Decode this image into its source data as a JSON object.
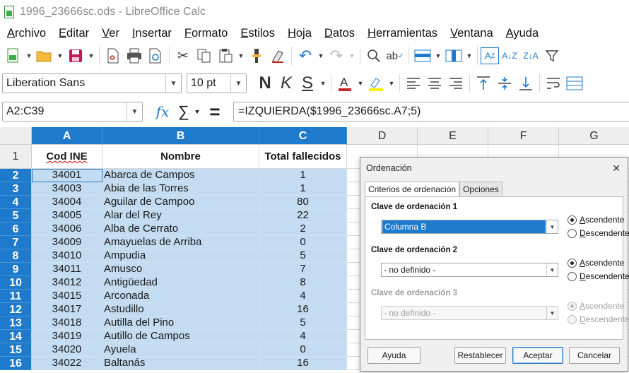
{
  "window": {
    "title": "1996_23666sc.ods - LibreOffice Calc"
  },
  "menu": [
    "Archivo",
    "Editar",
    "Ver",
    "Insertar",
    "Formato",
    "Estilos",
    "Hoja",
    "Datos",
    "Herramientas",
    "Ventana",
    "Ayuda"
  ],
  "toolbar2": {
    "font_name": "Liberation Sans",
    "font_size": "10 pt",
    "bold": "N",
    "italic": "K",
    "underline": "S"
  },
  "formula_bar": {
    "name_box": "A2:C39",
    "formula": "=IZQUIERDA($1996_23666sc.A7;5)",
    "fx": "fx",
    "sum": "∑",
    "equals": "="
  },
  "sheet": {
    "columns": [
      "A",
      "B",
      "C",
      "D",
      "E",
      "F",
      "G"
    ],
    "header_row": {
      "row": "1",
      "a": "Cod INE",
      "b": "Nombre",
      "c": "Total fallecidos"
    },
    "rows": [
      {
        "row": "2",
        "a": "34001",
        "b": "Abarca de Campos",
        "c": "1"
      },
      {
        "row": "3",
        "a": "34003",
        "b": "Abia de las Torres",
        "c": "1"
      },
      {
        "row": "4",
        "a": "34004",
        "b": "Aguilar de Campoo",
        "c": "80"
      },
      {
        "row": "5",
        "a": "34005",
        "b": "Alar del Rey",
        "c": "22"
      },
      {
        "row": "6",
        "a": "34006",
        "b": "Alba de Cerrato",
        "c": "2"
      },
      {
        "row": "7",
        "a": "34009",
        "b": "Amayuelas de Arriba",
        "c": "0"
      },
      {
        "row": "8",
        "a": "34010",
        "b": "Ampudia",
        "c": "5"
      },
      {
        "row": "9",
        "a": "34011",
        "b": "Amusco",
        "c": "7"
      },
      {
        "row": "10",
        "a": "34012",
        "b": "Antigüedad",
        "c": "8"
      },
      {
        "row": "11",
        "a": "34015",
        "b": "Arconada",
        "c": "4"
      },
      {
        "row": "12",
        "a": "34017",
        "b": "Astudillo",
        "c": "16"
      },
      {
        "row": "13",
        "a": "34018",
        "b": "Autilla del Pino",
        "c": "5"
      },
      {
        "row": "14",
        "a": "34019",
        "b": "Autillo de Campos",
        "c": "4"
      },
      {
        "row": "15",
        "a": "34020",
        "b": "Ayuela",
        "c": "0"
      },
      {
        "row": "16",
        "a": "34022",
        "b": "Baltanás",
        "c": "16"
      }
    ]
  },
  "sort_dialog": {
    "title": "Ordenación",
    "tabs": [
      "Criterios de ordenación",
      "Opciones"
    ],
    "keys": [
      {
        "label": "Clave de ordenación 1",
        "value": "Columna B",
        "asc": "Ascendente",
        "desc": "Descendente"
      },
      {
        "label": "Clave de ordenación 2",
        "value": "- no definido -",
        "asc": "Ascendente",
        "desc": "Descendente"
      },
      {
        "label": "Clave de ordenación 3",
        "value": "- no definido -",
        "asc": "Ascendente",
        "desc": "Descendente"
      }
    ],
    "buttons": {
      "help": "Ayuda",
      "reset": "Restablecer",
      "ok": "Aceptar",
      "cancel": "Cancelar"
    }
  },
  "colors": {
    "selection_header": "#1e7acc",
    "selection_fill": "#c4dcf1",
    "accent": "#2a78c9"
  }
}
